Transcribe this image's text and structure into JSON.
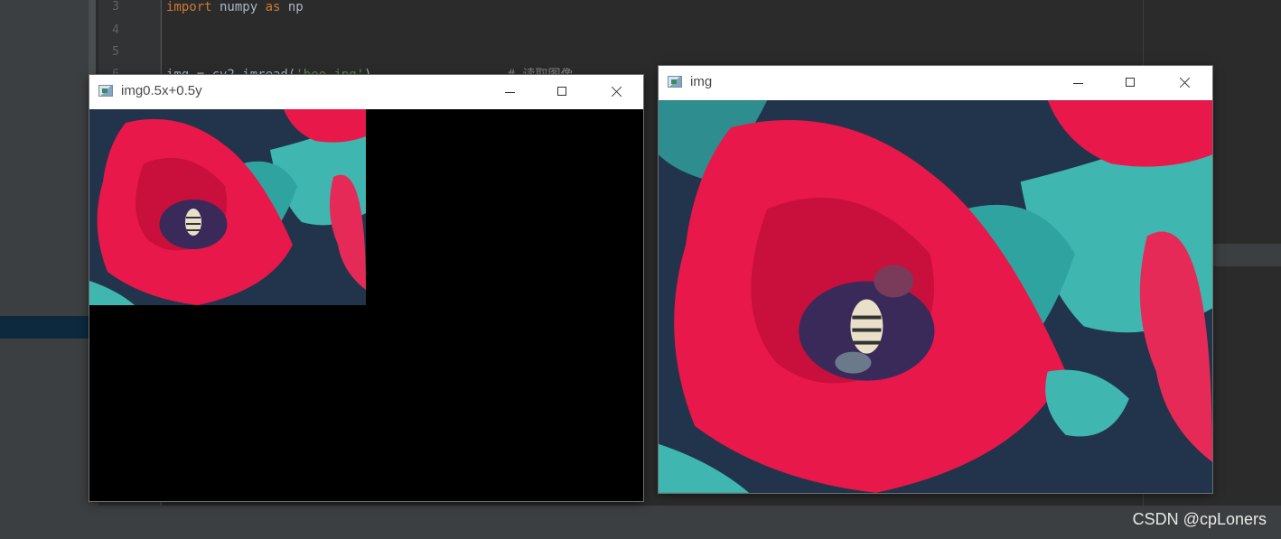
{
  "editor": {
    "lines": [
      {
        "num": "3",
        "code_keyword": "import",
        "code_rest": " numpy ",
        "code_keyword2": "as",
        "code_rest2": " np"
      },
      {
        "num": "4"
      },
      {
        "num": "5"
      },
      {
        "num": "6",
        "code_partial": "img = cv2.imread(",
        "code_string": "'bee.jpg'",
        "code_end": ")",
        "comment": "# 读取图像"
      }
    ]
  },
  "windows": {
    "shifted": {
      "title": "img0.5x+0.5y"
    },
    "original": {
      "title": "img"
    }
  },
  "watermark": "CSDN @cpLoners",
  "colors": {
    "petal": "#e8184a",
    "leaf": "#3fb6b0",
    "background_soil": "#24344a"
  }
}
